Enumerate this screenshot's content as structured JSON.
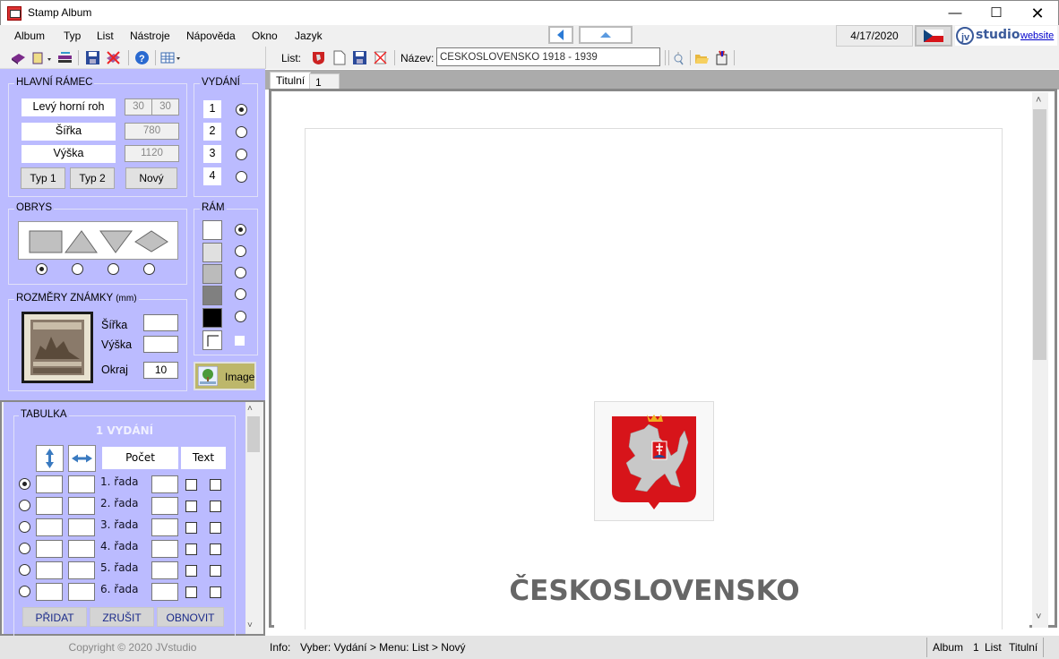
{
  "window": {
    "title": "Stamp Album",
    "controls": [
      "minimize",
      "maximize",
      "close"
    ]
  },
  "menu": [
    "Album",
    "Typ",
    "List",
    "Nástroje",
    "Nápověda",
    "Okno",
    "Jazyk"
  ],
  "header": {
    "date": "4/17/2020",
    "logo_text": "studio",
    "website_link": "website",
    "flag": "czech-flag"
  },
  "toolbar_left": {
    "icons": [
      "album-book-icon",
      "open-album-icon",
      "export-icon",
      "save-icon",
      "delete-album-icon",
      "help-icon",
      "grid-icon"
    ]
  },
  "toolbar_right": {
    "list_label": "List:",
    "icons": [
      "coat-of-arms-icon",
      "new-page-icon",
      "save-page-icon",
      "delete-page-icon"
    ],
    "name_label": "Název:",
    "name_value": "ČESKOSLOVENSKO 1918 - 1939",
    "icons_after": [
      "zoom-icon",
      "open-folder-icon",
      "paint-icon"
    ]
  },
  "main_frame": {
    "title": "HLAVNÍ RÁMEC",
    "top_left_label": "Levý horní roh",
    "top_left_x": "30",
    "top_left_y": "30",
    "width_label": "Šířka",
    "width_value": "780",
    "height_label": "Výška",
    "height_value": "1120",
    "buttons": [
      "Typ 1",
      "Typ 2",
      "Nový"
    ]
  },
  "issue": {
    "title": "VYDÁNÍ",
    "options": [
      "1",
      "2",
      "3",
      "4"
    ],
    "selected": "1"
  },
  "outline": {
    "title": "OBRYS",
    "shapes": [
      "rectangle",
      "triangle-up",
      "triangle-down",
      "diamond"
    ],
    "selected": "rectangle"
  },
  "frame": {
    "title": "RÁM",
    "swatches": [
      "#ffffff",
      "#e0e0e0",
      "#bbbbbb",
      "#808080",
      "#000000"
    ],
    "selected": 0
  },
  "stamp_size": {
    "title": "ROZMĚRY ZNÁMKY",
    "unit": "(mm)",
    "width_label": "Šířka",
    "width_value": "",
    "height_label": "Výška",
    "height_value": "",
    "margin_label": "Okraj",
    "margin_value": "10"
  },
  "image_button": "Image",
  "table": {
    "title": "TABULKA",
    "issue_heading": "1 VYDÁNÍ",
    "col_count": "Počet",
    "col_text": "Text",
    "rows": [
      "1. řada",
      "2. řada",
      "3. řada",
      "4. řada",
      "5. řada",
      "6. řada"
    ],
    "selected_row": 0,
    "buttons": [
      "PŘIDAT",
      "ZRUŠIT",
      "OBNOVIT"
    ]
  },
  "copyright": "Copyright © 2020 JVstudio",
  "tabs": [
    {
      "label": "Titulní",
      "active": true
    },
    {
      "label": "1",
      "active": false
    }
  ],
  "page": {
    "heading": "ČESKOSLOVENSKO",
    "emblem": "czechoslovak-coat-of-arms"
  },
  "status": {
    "info_label": "Info:",
    "info_text": "Vyber: Vydání > Menu: List > Nový",
    "right": [
      "Album",
      "1",
      "List",
      "Titulní"
    ]
  }
}
